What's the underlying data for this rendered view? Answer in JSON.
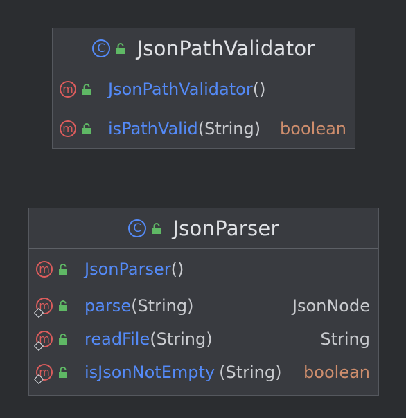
{
  "classes": [
    {
      "name": "JsonPathValidator",
      "icon": "class-icon",
      "members": [
        {
          "name": "JsonPathValidator",
          "params": "()",
          "return_type": "",
          "kind": "constructor"
        },
        {
          "name": "isPathValid",
          "params": "(String)",
          "return_type": "boolean",
          "kind": "method"
        }
      ]
    },
    {
      "name": "JsonParser",
      "icon": "class-icon",
      "members": [
        {
          "name": "JsonParser",
          "params": "()",
          "return_type": "",
          "kind": "constructor"
        },
        {
          "name": "parse",
          "params": "(String)",
          "return_type": "JsonNode",
          "kind": "method",
          "throws": true
        },
        {
          "name": "readFile",
          "params": "(String)",
          "return_type": "String",
          "kind": "method",
          "throws": true
        },
        {
          "name": "isJsonNotEmpty",
          "params": "(String)",
          "return_type": "boolean",
          "kind": "method",
          "throws": true
        }
      ]
    }
  ],
  "icons": {
    "class_letter": "C",
    "method_letter": "m"
  },
  "colors": {
    "background": "#2b2d30",
    "box_fill": "#393b40",
    "method_name": "#548af7",
    "primitive_type": "#cf8e6d",
    "method_icon": "#db5c5c",
    "class_icon": "#548af7",
    "lock_icon": "#5fb865"
  }
}
